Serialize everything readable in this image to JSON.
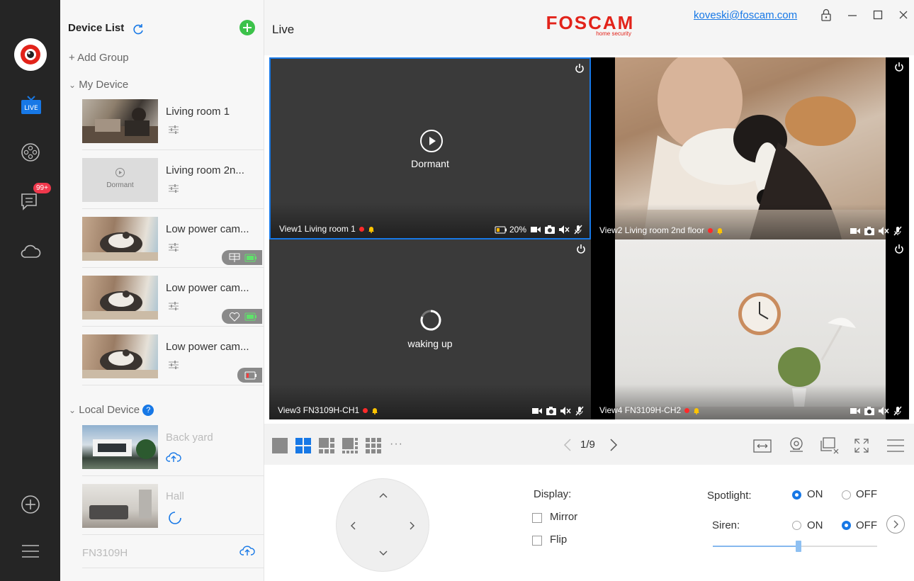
{
  "header": {
    "title": "Live",
    "brand": "FOSCAM",
    "brand_sub": "home security",
    "user_email": "koveski@foscam.com"
  },
  "rail": {
    "live_label": "LIVE",
    "notification_count": "99+"
  },
  "device_list": {
    "title": "Device List",
    "add_group": "+ Add Group",
    "my_device": "My Device",
    "my_devices": [
      {
        "name": "Living room 1"
      },
      {
        "name": "Living room 2n...",
        "thumb_text": "Dormant"
      },
      {
        "name": "Low power cam..."
      },
      {
        "name": "Low power cam..."
      },
      {
        "name": "Low power cam..."
      }
    ],
    "local_device": "Local Device",
    "local_devices": [
      {
        "name": "Back yard"
      },
      {
        "name": "Hall"
      },
      {
        "name": "FN3109H"
      }
    ]
  },
  "views": [
    {
      "label": "View1 Living room 1",
      "status": "Dormant",
      "battery": "20%"
    },
    {
      "label": "View2 Living room 2nd floor"
    },
    {
      "label": "View3 FN3109H-CH1",
      "status": "waking up"
    },
    {
      "label": "View4 FN3109H-CH2"
    }
  ],
  "toolbar": {
    "page": "1/9",
    "more": "···"
  },
  "controls": {
    "display_label": "Display:",
    "mirror_label": "Mirror",
    "flip_label": "Flip",
    "spotlight_label": "Spotlight:",
    "siren_label": "Siren:",
    "on_label": "ON",
    "off_label": "OFF",
    "spotlight_state": "ON",
    "siren_state": "OFF",
    "slider_fraction": 0.52
  },
  "colors": {
    "accent": "#1778e6",
    "brand": "#e2231a",
    "rail": "#252525",
    "record": "#ff2a2a",
    "bell": "#ffc400"
  }
}
